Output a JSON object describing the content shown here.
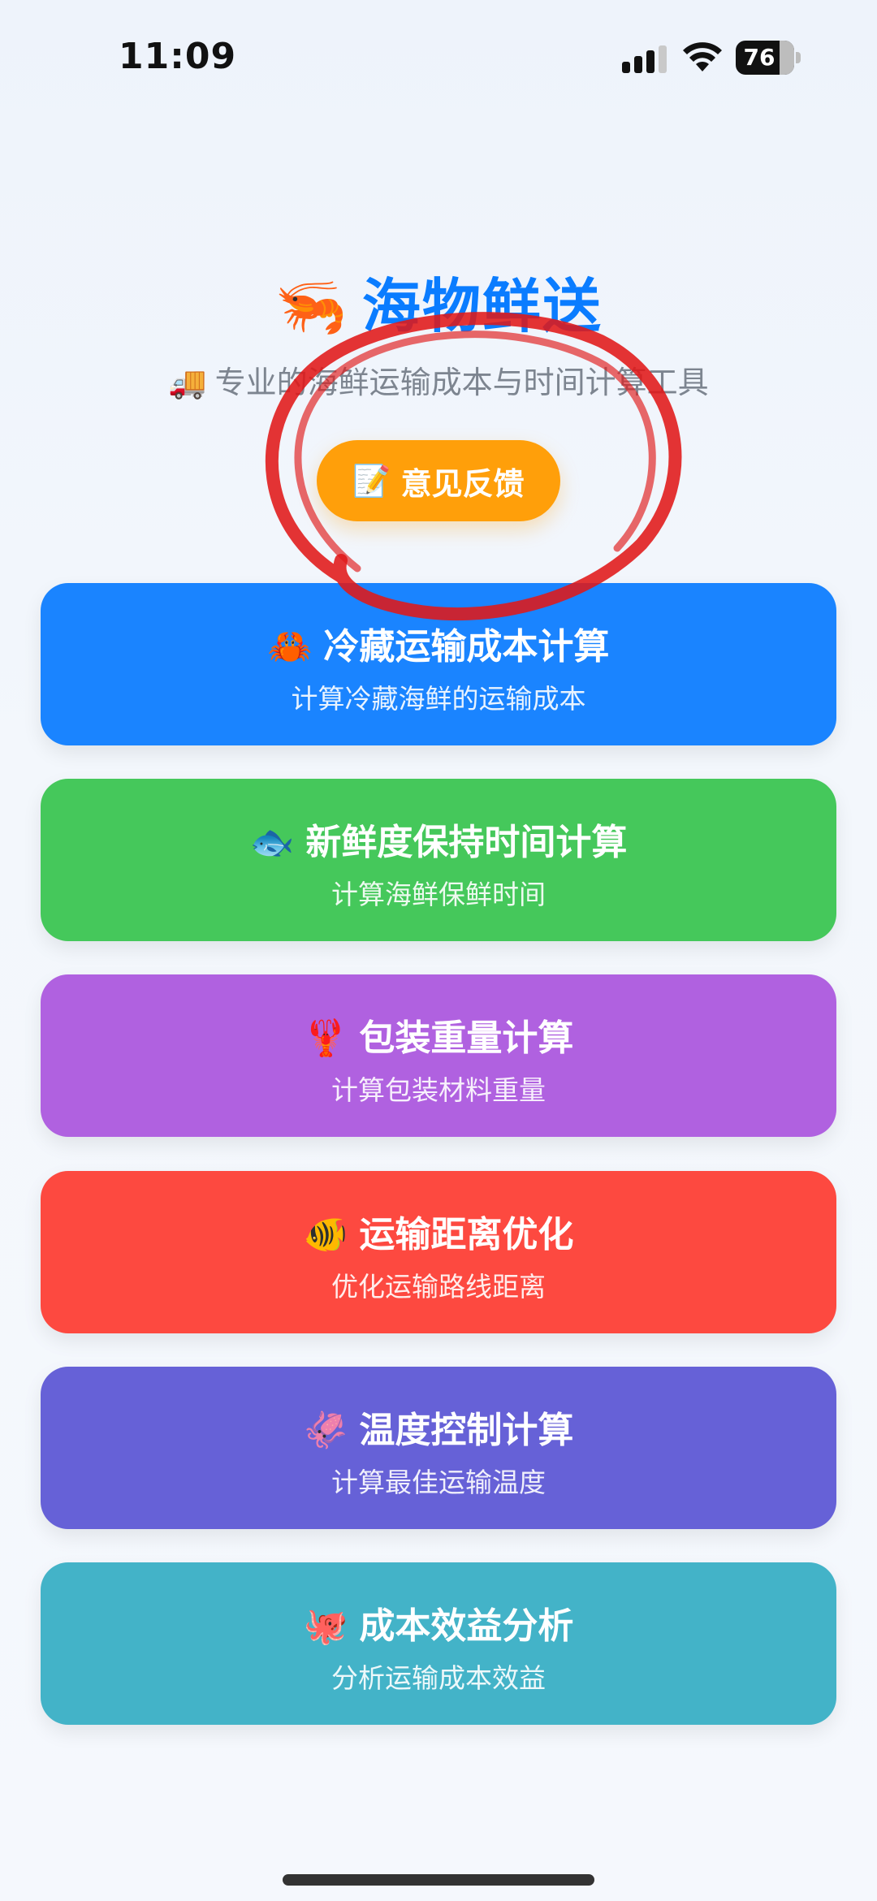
{
  "status_bar": {
    "time": "11:09",
    "battery": "76"
  },
  "header": {
    "title_emoji": "🦐",
    "title": "海物鲜送",
    "subtitle_emoji": "🚚",
    "subtitle": "专业的海鲜运输成本与时间计算工具"
  },
  "feedback": {
    "emoji": "📝",
    "label": "意见反馈"
  },
  "cards": [
    {
      "emoji": "🦀",
      "title": "冷藏运输成本计算",
      "subtitle": "计算冷藏海鲜的运输成本",
      "color": "#1a84ff"
    },
    {
      "emoji": "🐟",
      "title": "新鲜度保持时间计算",
      "subtitle": "计算海鲜保鲜时间",
      "color": "#45c85b"
    },
    {
      "emoji": "🦞",
      "title": "包装重量计算",
      "subtitle": "计算包装材料重量",
      "color": "#b061e0"
    },
    {
      "emoji": "🐠",
      "title": "运输距离优化",
      "subtitle": "优化运输路线距离",
      "color": "#fd4940"
    },
    {
      "emoji": "🦑",
      "title": "温度控制计算",
      "subtitle": "计算最佳运输温度",
      "color": "#6661d7"
    },
    {
      "emoji": "🐙",
      "title": "成本效益分析",
      "subtitle": "分析运输成本效益",
      "color": "#43b3c8"
    }
  ],
  "colors": {
    "title": "#0a7cff",
    "feedback": "#ff9f0a",
    "annotation": "#e01818"
  }
}
